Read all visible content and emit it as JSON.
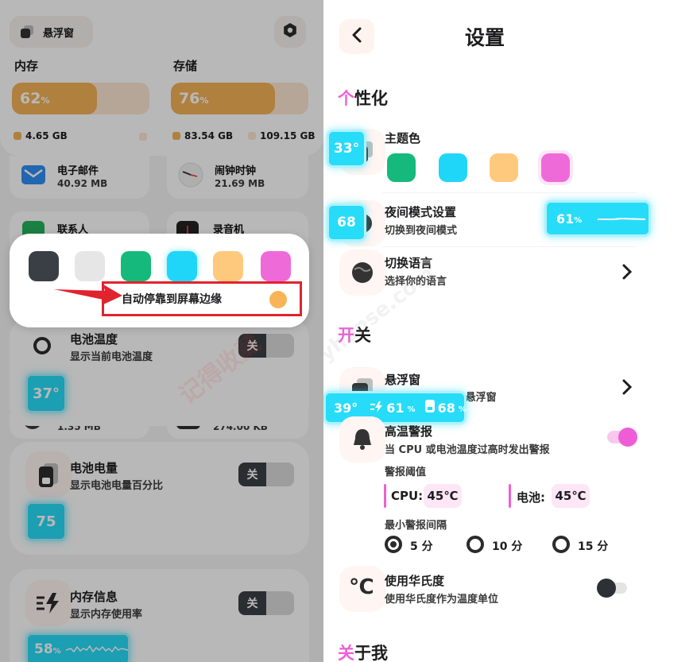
{
  "left": {
    "top_label": "悬浮窗",
    "memory_label": "内存",
    "storage_label": "存储",
    "memory_percent": "62",
    "memory_fill": 0.62,
    "storage_percent": "76",
    "storage_fill": 0.76,
    "pct_unit": "%",
    "memory_used": "4.65 GB",
    "storage_used": "83.54 GB",
    "storage_total": "109.15 GB",
    "apps": [
      {
        "name": "电子邮件",
        "size": "40.92 MB"
      },
      {
        "name": "闹钟时钟",
        "size": "21.69 MB"
      },
      {
        "name": "联系人",
        "size": ""
      },
      {
        "name": "录音机",
        "size": ""
      },
      {
        "name": "",
        "size": "1.35 MB"
      },
      {
        "name": "",
        "size": "274.00 KB"
      }
    ],
    "popup": {
      "swatches": [
        "#3a3f45",
        "#e6e6e6",
        "#15b97c",
        "#1fd6f8",
        "#ffc97d",
        "#ef6ad9"
      ],
      "snap_label": "自动停靠到屏幕边缘",
      "watermark": "记得收藏"
    },
    "battery_temp": {
      "title": "电池温度",
      "subtitle": "显示当前电池温度",
      "toggle": "关",
      "value": "37°"
    },
    "battery_level": {
      "title": "电池电量",
      "subtitle": "显示电池电量百分比",
      "toggle": "关",
      "value": "75"
    },
    "memory_info": {
      "title": "内存信息",
      "subtitle": "显示内存使用率",
      "toggle": "关",
      "value": "58",
      "unit": "%"
    }
  },
  "right": {
    "title": "设置",
    "personal_first": "个",
    "personal_rest": "性化",
    "theme_color_label": "主题色",
    "theme_colors": [
      "#15b97c",
      "#1fd6f8",
      "#ffc97d",
      "#ef6ad9"
    ],
    "floating_temp": "33°",
    "floating_night": "68",
    "night_title": "夜间模式设置",
    "night_subtitle": "切换到夜间模式",
    "night_widget_value": "61",
    "night_widget_unit": "%",
    "language_title": "切换语言",
    "language_subtitle": "选择你的语言",
    "switch_first": "开",
    "switch_rest": "关",
    "floating_window_title": "悬浮窗",
    "floating_window_subtitle": "多种 pod 的电池悬浮窗",
    "floating_bar": {
      "temp": "39°",
      "charge": "61",
      "battery": "68",
      "unit": "%"
    },
    "alert_title": "高温警报",
    "alert_subtitle": "当 CPU 或电池温度过高时发出警报",
    "threshold_label": "警报阈值",
    "cpu_label": "CPU:",
    "cpu_value": "45℃",
    "battery_label": "电池:",
    "battery_value": "45℃",
    "interval_label": "最小警报间隔",
    "intervals": [
      "5 分",
      "10 分",
      "15 分"
    ],
    "selected_interval": 0,
    "fahrenheit_title": "使用华氏度",
    "fahrenheit_subtitle": "使用华氏度作为温度单位",
    "about_first": "关",
    "about_rest": "于我",
    "watermark": "yhanse.com"
  }
}
